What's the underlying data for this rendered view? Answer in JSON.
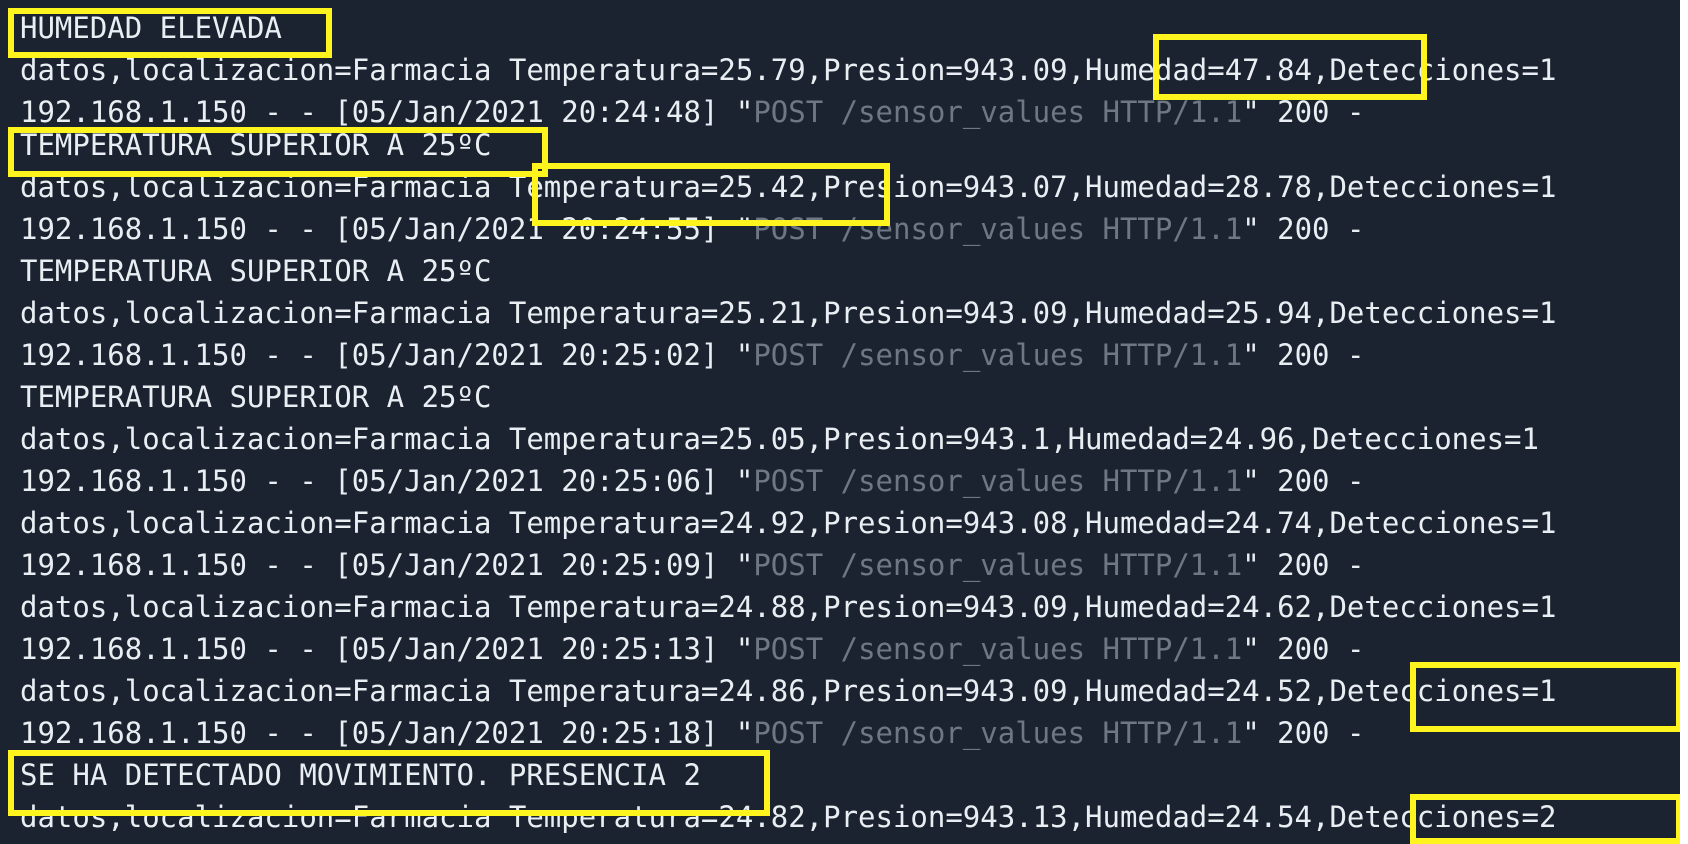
{
  "colors": {
    "background": "#1b2330",
    "text": "#e9eef3",
    "dim_text": "#6e7884",
    "highlight": "#fff41d"
  },
  "lines": [
    {
      "kind": "alert",
      "text": "HUMEDAD ELEVADA"
    },
    {
      "kind": "data",
      "text": "datos,localizacion=Farmacia Temperatura=25.79,Presion=943.09,Humedad=47.84,Detecciones=1"
    },
    {
      "kind": "log",
      "prefix": "192.168.1.150 - - [05/Jan/2021 20:24:48] \"",
      "request": "POST /sensor_values HTTP/1.1",
      "suffix": "\" 200 -"
    },
    {
      "kind": "alert",
      "text": "TEMPERATURA SUPERIOR A 25ºC"
    },
    {
      "kind": "data",
      "text": "datos,localizacion=Farmacia Temperatura=25.42,Presion=943.07,Humedad=28.78,Detecciones=1"
    },
    {
      "kind": "log",
      "prefix": "192.168.1.150 - - [05/Jan/2021 20:24:55] \"",
      "request": "POST /sensor_values HTTP/1.1",
      "suffix": "\" 200 -"
    },
    {
      "kind": "alert",
      "text": "TEMPERATURA SUPERIOR A 25ºC"
    },
    {
      "kind": "data",
      "text": "datos,localizacion=Farmacia Temperatura=25.21,Presion=943.09,Humedad=25.94,Detecciones=1"
    },
    {
      "kind": "log",
      "prefix": "192.168.1.150 - - [05/Jan/2021 20:25:02] \"",
      "request": "POST /sensor_values HTTP/1.1",
      "suffix": "\" 200 -"
    },
    {
      "kind": "alert",
      "text": "TEMPERATURA SUPERIOR A 25ºC"
    },
    {
      "kind": "data",
      "text": "datos,localizacion=Farmacia Temperatura=25.05,Presion=943.1,Humedad=24.96,Detecciones=1"
    },
    {
      "kind": "log",
      "prefix": "192.168.1.150 - - [05/Jan/2021 20:25:06] \"",
      "request": "POST /sensor_values HTTP/1.1",
      "suffix": "\" 200 -"
    },
    {
      "kind": "data",
      "text": "datos,localizacion=Farmacia Temperatura=24.92,Presion=943.08,Humedad=24.74,Detecciones=1"
    },
    {
      "kind": "log",
      "prefix": "192.168.1.150 - - [05/Jan/2021 20:25:09] \"",
      "request": "POST /sensor_values HTTP/1.1",
      "suffix": "\" 200 -"
    },
    {
      "kind": "data",
      "text": "datos,localizacion=Farmacia Temperatura=24.88,Presion=943.09,Humedad=24.62,Detecciones=1"
    },
    {
      "kind": "log",
      "prefix": "192.168.1.150 - - [05/Jan/2021 20:25:13] \"",
      "request": "POST /sensor_values HTTP/1.1",
      "suffix": "\" 200 -"
    },
    {
      "kind": "data",
      "text": "datos,localizacion=Farmacia Temperatura=24.86,Presion=943.09,Humedad=24.52,Detecciones=1"
    },
    {
      "kind": "log",
      "prefix": "192.168.1.150 - - [05/Jan/2021 20:25:18] \"",
      "request": "POST /sensor_values HTTP/1.1",
      "suffix": "\" 200 -"
    },
    {
      "kind": "alert",
      "text": "SE HA DETECTADO MOVIMIENTO. PRESENCIA 2"
    },
    {
      "kind": "data",
      "text": "datos,localizacion=Farmacia Temperatura=24.82,Presion=943.13,Humedad=24.54,Detecciones=2"
    }
  ],
  "highlights": [
    {
      "text": "HUMEDAD ELEVADA"
    },
    {
      "text": "Humedad=47.84"
    },
    {
      "text": "TEMPERATURA SUPERIOR A 25ºC"
    },
    {
      "text": "Temperatura=25.42"
    },
    {
      "text": "Detecciones=1"
    },
    {
      "text": "SE HA DETECTADO MOVIMIENTO. PRESENCIA 2"
    },
    {
      "text": "Detecciones=2"
    }
  ]
}
